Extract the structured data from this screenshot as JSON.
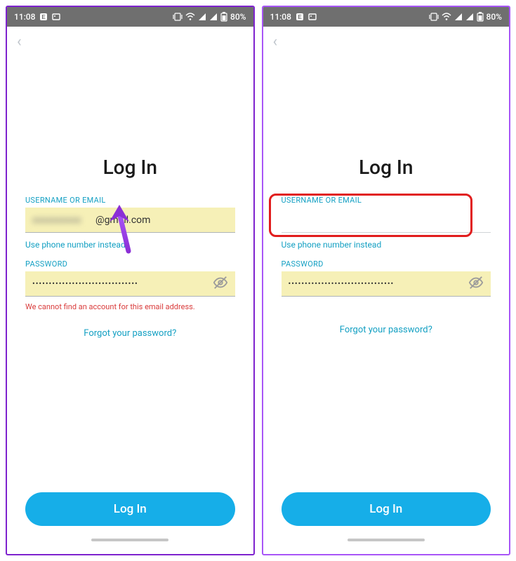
{
  "status": {
    "time": "11:08",
    "battery": "80%"
  },
  "screen1": {
    "title": "Log In",
    "username_label": "USERNAME OR EMAIL",
    "username_value": "@gmail.com",
    "alt_link": "Use phone number instead",
    "password_label": "PASSWORD",
    "password_value": "••••••••••••••••••••••••••••••••",
    "error": "We cannot find an account for this email address.",
    "forgot": "Forgot your password?",
    "login_button": "Log In"
  },
  "screen2": {
    "title": "Log In",
    "username_label": "USERNAME OR EMAIL",
    "username_value": "         ",
    "alt_link": "Use phone number instead",
    "password_label": "PASSWORD",
    "password_value": "••••••••••••••••••••••••••••••••",
    "forgot": "Forgot your password?",
    "login_button": "Log In"
  }
}
